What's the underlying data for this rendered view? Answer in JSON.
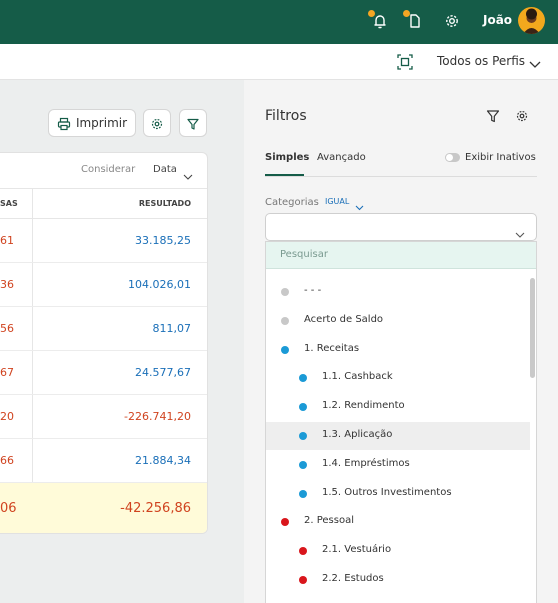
{
  "header": {
    "user_name": "João",
    "icons": [
      "bell-icon",
      "document-icon",
      "gear-icon"
    ],
    "brand_color": "#155c48",
    "badge_color": "#f5a623"
  },
  "subbar": {
    "profile_selector": "Todos os Perfis"
  },
  "toolbar": {
    "print_label": "Imprimir"
  },
  "table": {
    "considerar_label": "Considerar",
    "data_label": "Data",
    "col_left_header": "SAS",
    "col_result_header": "RESULTADO",
    "rows": [
      {
        "left": "61",
        "result": "33.185,25",
        "result_sign": "pos"
      },
      {
        "left": "36",
        "result": "104.026,01",
        "result_sign": "pos"
      },
      {
        "left": "56",
        "result": "811,07",
        "result_sign": "pos"
      },
      {
        "left": "67",
        "result": "24.577,67",
        "result_sign": "pos"
      },
      {
        "left": "20",
        "result": "-226.741,20",
        "result_sign": "neg"
      },
      {
        "left": "66",
        "result": "21.884,34",
        "result_sign": "pos"
      }
    ],
    "total": {
      "left": "06",
      "result": "-42.256,86"
    }
  },
  "filters": {
    "title": "Filtros",
    "tab_simple": "Simples",
    "tab_advanced": "Avançado",
    "show_inactive_label": "Exibir Inativos",
    "show_inactive": false,
    "categories_label": "Categorias",
    "operator_label": "IGUAL",
    "categories_value": "",
    "search_placeholder": "Pesquisar",
    "options": [
      {
        "label": "- - -",
        "color": "#c8c8c8",
        "level": 0
      },
      {
        "label": "Acerto de Saldo",
        "color": "#c8c8c8",
        "level": 0
      },
      {
        "label": "1. Receitas",
        "color": "#1b9ad6",
        "level": 0
      },
      {
        "label": "1.1. Cashback",
        "color": "#1b9ad6",
        "level": 1
      },
      {
        "label": "1.2. Rendimento",
        "color": "#1b9ad6",
        "level": 1
      },
      {
        "label": "1.3. Aplicação",
        "color": "#1b9ad6",
        "level": 1,
        "hovered": true
      },
      {
        "label": "1.4. Empréstimos",
        "color": "#1b9ad6",
        "level": 1
      },
      {
        "label": "1.5. Outros Investimentos",
        "color": "#1b9ad6",
        "level": 1
      },
      {
        "label": "2. Pessoal",
        "color": "#d9161c",
        "level": 0
      },
      {
        "label": "2.1. Vestuário",
        "color": "#d9161c",
        "level": 1
      },
      {
        "label": "2.2. Estudos",
        "color": "#d9161c",
        "level": 1
      }
    ]
  }
}
